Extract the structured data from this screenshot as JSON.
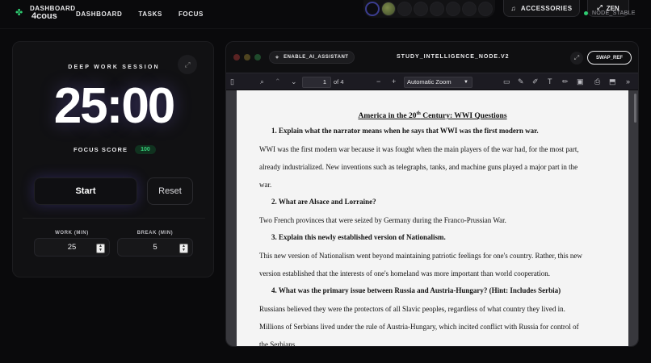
{
  "topbar": {
    "logo_line1": "DASHBOARD",
    "logo_line2": "4cous",
    "nav": [
      "DASHBOARD",
      "TASKS",
      "FOCUS"
    ],
    "accessories_label": "ACCESSORIES",
    "zen_label": "ZEN",
    "status_label": "NODE_STABLE",
    "status_color": "#2ecc71"
  },
  "session": {
    "heading": "DEEP WORK SESSION",
    "timer": "25:00",
    "focus_label": "FOCUS SCORE",
    "focus_value": "100",
    "start_label": "Start",
    "reset_label": "Reset",
    "work_label": "WORK (MIN)",
    "work_value": "25",
    "break_label": "BREAK (MIN)",
    "break_value": "5"
  },
  "reader": {
    "ai_label": "ENABLE_AI_ASSISTANT",
    "title": "STUDY_INTELLIGENCE_NODE.V2",
    "swap_label": "SWAP_REF",
    "page_current": "1",
    "page_total": "of 4",
    "zoom": "Automatic Zoom"
  },
  "document": {
    "title_pre": "America in the 20",
    "title_sup": "th",
    "title_post": " Century: WWI Questions",
    "q1": "1.   Explain what the narrator means when he says that WWI was the first modern war.",
    "a1_l1": "WWI was the first modern war because it was fought when the main players of the war had, for the most part,",
    "a1_l2": "already industrialized. New inventions such as telegraphs, tanks, and machine guns played a major part in the",
    "a1_l3": "war.",
    "q2": "2.   What are Alsace and Lorraine?",
    "a2_l1": "Two French provinces that were seized by Germany during the Franco-Prussian War.",
    "q3": "3.   Explain this newly established version of Nationalism.",
    "a3_l1": "This new version of Nationalism went beyond maintaining patriotic feelings for one's country. Rather, this new",
    "a3_l2": "version established that the interests of one's homeland was more important than world cooperation.",
    "q4": "4.   What was the primary issue between Russia and Austria-Hungary? (Hint: Includes Serbia)",
    "a4_l1": "Russians believed they were the protectors of all Slavic peoples, regardless of what country they lived in.",
    "a4_l2": "Millions of Serbians lived under the rule of Austria-Hungary, which incited conflict with Russia for control of",
    "a4_l3": "the Serbians."
  }
}
